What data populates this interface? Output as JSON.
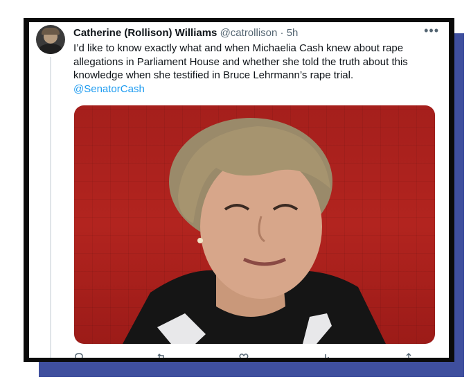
{
  "tweet": {
    "author_name": "Catherine (Rollison) Williams",
    "handle": "@catrollison",
    "separator": "·",
    "time": "5h",
    "more_label": "•••",
    "body": "I’d like to know exactly what and when Michaelia Cash knew about rape allegations in Parliament House and whether she told the truth about this knowledge when she testified in Bruce Lehrmann’s rape trial.",
    "mention": "@SenatorCash"
  },
  "actions": [
    {
      "icon": "reply-icon",
      "count": ""
    },
    {
      "icon": "retweet-icon",
      "count": ""
    },
    {
      "icon": "like-icon",
      "count": ""
    },
    {
      "icon": "views-icon",
      "count": ""
    },
    {
      "icon": "share-icon",
      "count": ""
    }
  ],
  "colors": {
    "frame": "#0b0b0b",
    "shadow": "#3f4f9e",
    "link": "#1d9bf0",
    "photo_background": "#a51f1c"
  }
}
